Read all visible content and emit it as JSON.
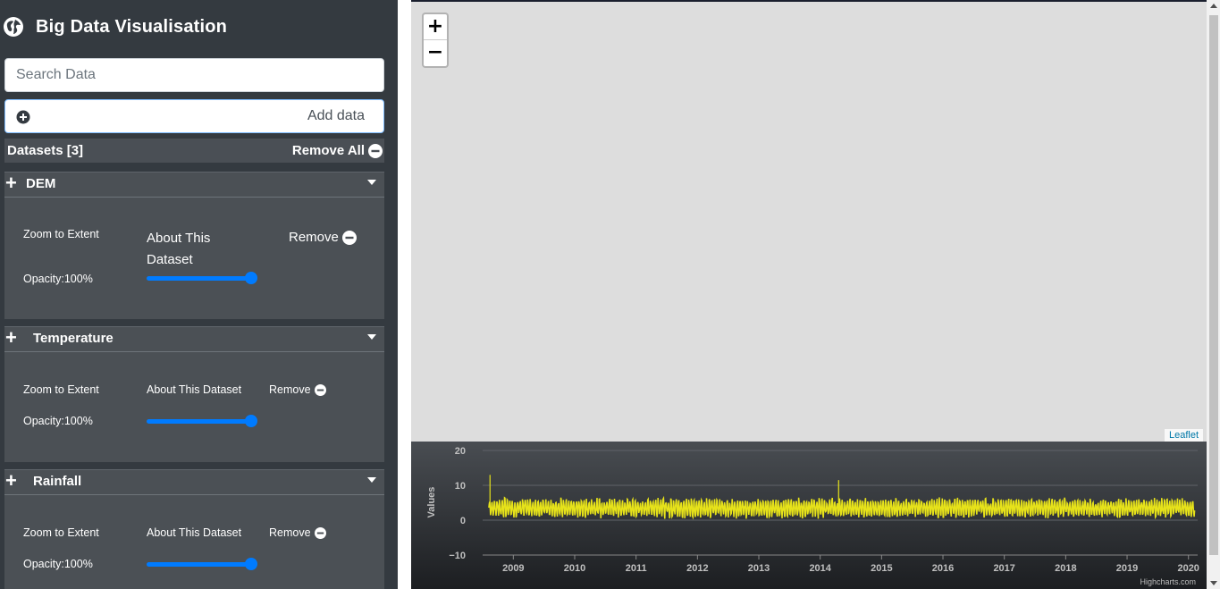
{
  "app": {
    "title": "Big Data Visualisation",
    "icon": "globe-icon"
  },
  "search": {
    "placeholder": "Search Data",
    "value": ""
  },
  "add_data": {
    "label": "Add data"
  },
  "datasets": {
    "header": "Datasets [3]",
    "remove_all": "Remove All",
    "items": [
      {
        "name": "DEM",
        "zoom": "Zoom to Extent",
        "about": "About This Dataset",
        "remove": "Remove",
        "opacity": "Opacity:100%",
        "opacity_value": 1.0
      },
      {
        "name": "Temperature",
        "zoom": "Zoom to Extent",
        "about": "About This Dataset",
        "remove": "Remove",
        "opacity": "Opacity:100%",
        "opacity_value": 1.0
      },
      {
        "name": "Rainfall",
        "zoom": "Zoom to Extent",
        "about": "About This Dataset",
        "remove": "Remove",
        "opacity": "Opacity:100%",
        "opacity_value": 1.0
      }
    ]
  },
  "map": {
    "zoom_in": "+",
    "zoom_out": "−",
    "attribution": "Leaflet"
  },
  "chart_data": {
    "type": "line",
    "ylabel": "Values",
    "xlabel": "",
    "x_ticks": [
      "2009",
      "2010",
      "2011",
      "2012",
      "2013",
      "2014",
      "2015",
      "2016",
      "2017",
      "2018",
      "2019",
      "2020"
    ],
    "y_ticks": [
      "20",
      "10",
      "0",
      "−10"
    ],
    "ylim": [
      -10,
      20
    ],
    "xlim": [
      2008.5,
      2020.15
    ],
    "series_color": "#e6e21a",
    "credit": "Highcharts.com",
    "series": [
      {
        "x_start": 2008.6,
        "x_end": 2020.1,
        "baseline": 3.5,
        "amplitude": 2.5,
        "cycles_per_year": 24,
        "spikes": [
          {
            "x": 2008.62,
            "y": 13
          },
          {
            "x": 2014.3,
            "y": 11.5
          }
        ]
      }
    ]
  }
}
